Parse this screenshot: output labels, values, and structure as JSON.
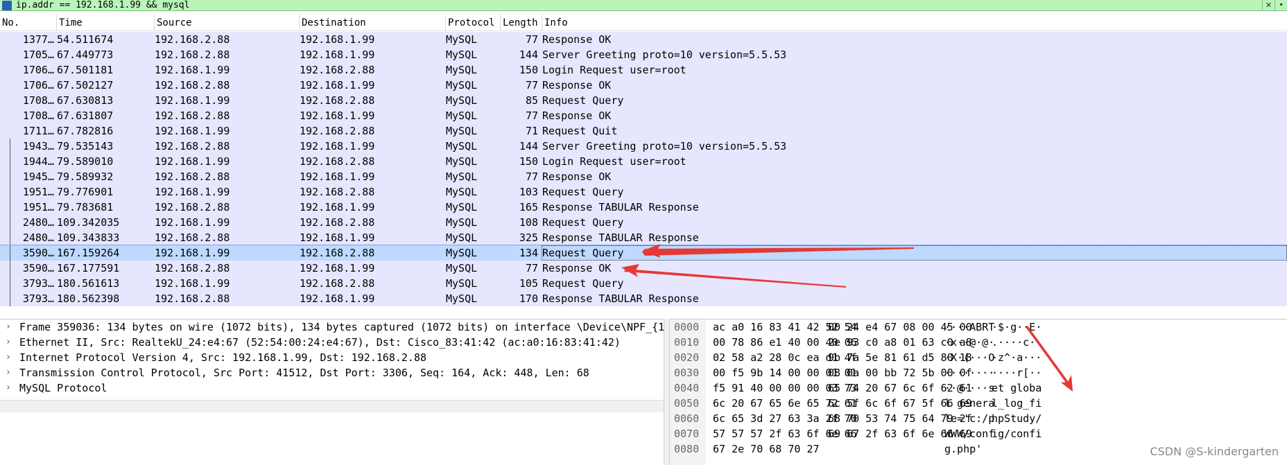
{
  "filter": {
    "value": "ip.addr == 192.168.1.99 && mysql",
    "close_glyph": "✕",
    "dropdown_glyph": "▾"
  },
  "columns": [
    "No.",
    "Time",
    "Source",
    "Destination",
    "Protocol",
    "Length",
    "Info"
  ],
  "packets": [
    {
      "no": "1377…",
      "time": "54.511674",
      "src": "192.168.2.88",
      "dst": "192.168.1.99",
      "proto": "MySQL",
      "len": "77",
      "info": "Response  OK"
    },
    {
      "no": "1705…",
      "time": "67.449773",
      "src": "192.168.2.88",
      "dst": "192.168.1.99",
      "proto": "MySQL",
      "len": "144",
      "info": "Server Greeting  proto=10 version=5.5.53"
    },
    {
      "no": "1706…",
      "time": "67.501181",
      "src": "192.168.1.99",
      "dst": "192.168.2.88",
      "proto": "MySQL",
      "len": "150",
      "info": "Login Request user=root"
    },
    {
      "no": "1706…",
      "time": "67.502127",
      "src": "192.168.2.88",
      "dst": "192.168.1.99",
      "proto": "MySQL",
      "len": "77",
      "info": "Response  OK"
    },
    {
      "no": "1708…",
      "time": "67.630813",
      "src": "192.168.1.99",
      "dst": "192.168.2.88",
      "proto": "MySQL",
      "len": "85",
      "info": "Request Query"
    },
    {
      "no": "1708…",
      "time": "67.631807",
      "src": "192.168.2.88",
      "dst": "192.168.1.99",
      "proto": "MySQL",
      "len": "77",
      "info": "Response  OK"
    },
    {
      "no": "1711…",
      "time": "67.782816",
      "src": "192.168.1.99",
      "dst": "192.168.2.88",
      "proto": "MySQL",
      "len": "71",
      "info": "Request Quit"
    },
    {
      "no": "1943…",
      "time": "79.535143",
      "src": "192.168.2.88",
      "dst": "192.168.1.99",
      "proto": "MySQL",
      "len": "144",
      "info": "Server Greeting  proto=10 version=5.5.53"
    },
    {
      "no": "1944…",
      "time": "79.589010",
      "src": "192.168.1.99",
      "dst": "192.168.2.88",
      "proto": "MySQL",
      "len": "150",
      "info": "Login Request user=root"
    },
    {
      "no": "1945…",
      "time": "79.589932",
      "src": "192.168.2.88",
      "dst": "192.168.1.99",
      "proto": "MySQL",
      "len": "77",
      "info": "Response  OK"
    },
    {
      "no": "1951…",
      "time": "79.776901",
      "src": "192.168.1.99",
      "dst": "192.168.2.88",
      "proto": "MySQL",
      "len": "103",
      "info": "Request Query"
    },
    {
      "no": "1951…",
      "time": "79.783681",
      "src": "192.168.2.88",
      "dst": "192.168.1.99",
      "proto": "MySQL",
      "len": "165",
      "info": "Response TABULAR Response"
    },
    {
      "no": "2480…",
      "time": "109.342035",
      "src": "192.168.1.99",
      "dst": "192.168.2.88",
      "proto": "MySQL",
      "len": "108",
      "info": "Request Query"
    },
    {
      "no": "2480…",
      "time": "109.343833",
      "src": "192.168.2.88",
      "dst": "192.168.1.99",
      "proto": "MySQL",
      "len": "325",
      "info": "Response TABULAR Response"
    },
    {
      "no": "3590…",
      "time": "167.159264",
      "src": "192.168.1.99",
      "dst": "192.168.2.88",
      "proto": "MySQL",
      "len": "134",
      "info": "Request Query",
      "selected": true
    },
    {
      "no": "3590…",
      "time": "167.177591",
      "src": "192.168.2.88",
      "dst": "192.168.1.99",
      "proto": "MySQL",
      "len": "77",
      "info": "Response  OK"
    },
    {
      "no": "3793…",
      "time": "180.561613",
      "src": "192.168.1.99",
      "dst": "192.168.2.88",
      "proto": "MySQL",
      "len": "105",
      "info": "Request Query"
    },
    {
      "no": "3793…",
      "time": "180.562398",
      "src": "192.168.2.88",
      "dst": "192.168.1.99",
      "proto": "MySQL",
      "len": "170",
      "info": "Response TABULAR Response"
    }
  ],
  "details": [
    "Frame 359036: 134 bytes on wire (1072 bits), 134 bytes captured (1072 bits) on interface \\Device\\NPF_{1",
    "Ethernet II, Src: RealtekU_24:e4:67 (52:54:00:24:e4:67), Dst: Cisco_83:41:42 (ac:a0:16:83:41:42)",
    "Internet Protocol Version 4, Src: 192.168.1.99, Dst: 192.168.2.88",
    "Transmission Control Protocol, Src Port: 41512, Dst Port: 3306, Seq: 164, Ack: 448, Len: 68",
    "MySQL Protocol"
  ],
  "detail_chevron": "›",
  "bytes": [
    {
      "off": "0000",
      "hex1": "ac a0 16 83 41 42 52 54",
      "hex2": "00 24 e4 67 08 00 45 00",
      "asc1": "····ABRT",
      "asc2": "·$·g··E·"
    },
    {
      "off": "0010",
      "hex1": "00 78 86 e1 40 00 40 06",
      "hex2": "2e 93 c0 a8 01 63 c0 a8",
      "asc1": "·x··@·@·",
      "asc2": ".····c··"
    },
    {
      "off": "0020",
      "hex1": "02 58 a2 28 0c ea d1 4f",
      "hex2": "9b 7a 5e 81 61 d5 80 18",
      "asc1": "·X·(···O",
      "asc2": "·z^·a···"
    },
    {
      "off": "0030",
      "hex1": "00 f5 9b 14 00 00 01 01",
      "hex2": "08 0a 00 bb 72 5b 00 0f",
      "asc1": "········",
      "asc2": "····r[··"
    },
    {
      "off": "0040",
      "hex1": "f5 91 40 00 00 00 03 73",
      "hex2": "65 74 20 67 6c 6f 62 61",
      "asc1": "··@····s",
      "asc2": "et globa"
    },
    {
      "off": "0050",
      "hex1": "6c 20 67 65 6e 65 72 61",
      "hex2": "6c 5f 6c 6f 67 5f 66 69",
      "asc1": "l genera",
      "asc2": "l_log_fi"
    },
    {
      "off": "0060",
      "hex1": "6c 65 3d 27 63 3a 2f 70",
      "hex2": "68 70 53 74 75 64 79 2f",
      "asc1": "le='c:/p",
      "asc2": "hpStudy/"
    },
    {
      "off": "0070",
      "hex1": "57 57 57 2f 63 6f 6e 66",
      "hex2": "69 67 2f 63 6f 6e 66 69",
      "asc1": "WWW/conf",
      "asc2": "ig/confi"
    },
    {
      "off": "0080",
      "hex1": "67 2e 70 68 70 27",
      "hex2": "",
      "asc1": "g.php'",
      "asc2": ""
    }
  ],
  "watermark": "CSDN @S-kindergarten",
  "arrow_color": "#e53935"
}
